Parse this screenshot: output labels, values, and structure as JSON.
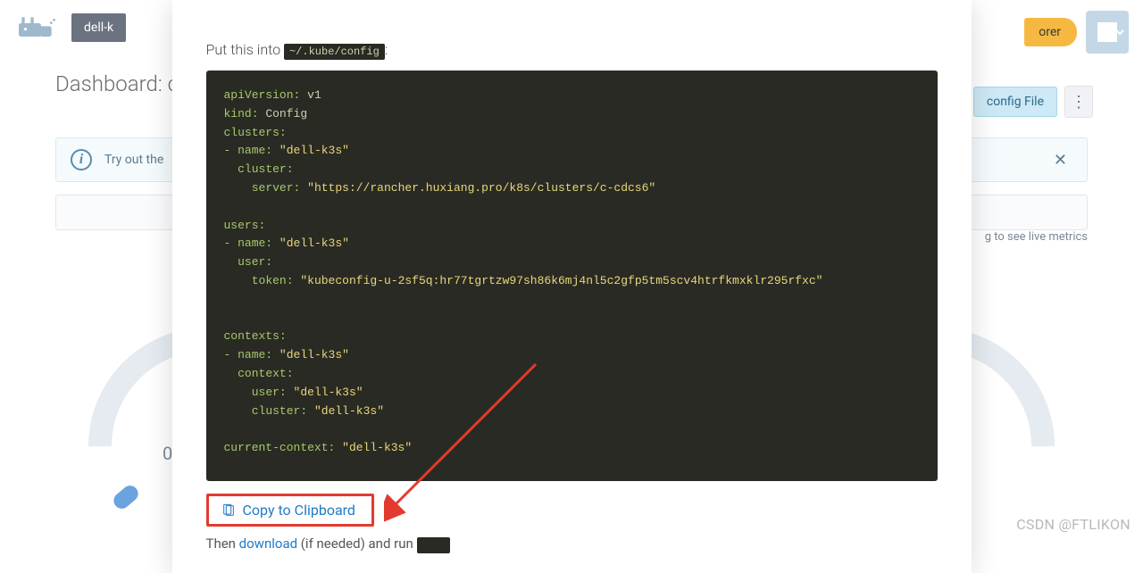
{
  "topbar": {
    "cluster_name": "dell-k",
    "explorer_btn": "orer"
  },
  "dashboard": {
    "title": "Dashboard: c"
  },
  "rightbtns": {
    "config_file": "config File"
  },
  "banner": {
    "text": "Try out the"
  },
  "metrics_hint": "g to see live metrics",
  "gauge": {
    "left_value": "0."
  },
  "modal": {
    "put_into_prefix": "Put this into ",
    "put_into_path": "~/.kube/config",
    "copy_label": "Copy to Clipboard",
    "then_text": "Then ",
    "download": "download",
    "then_tail": " (if needed) and run "
  },
  "kubeconfig": {
    "apiVersion": "v1",
    "kind": "Config",
    "cluster_name": "dell-k3s",
    "server": "https://rancher.huxiang.pro/k8s/clusters/c-cdcs6",
    "user_name": "dell-k3s",
    "token": "kubeconfig-u-2sf5q:hr77tgrtzw97sh86k6mj4nl5c2gfp5tm5scv4htrfkmxklr295rfxc",
    "context_name": "dell-k3s",
    "context_user": "dell-k3s",
    "context_cluster": "dell-k3s",
    "current_context": "dell-k3s"
  },
  "watermark": "CSDN @FTLIKON"
}
